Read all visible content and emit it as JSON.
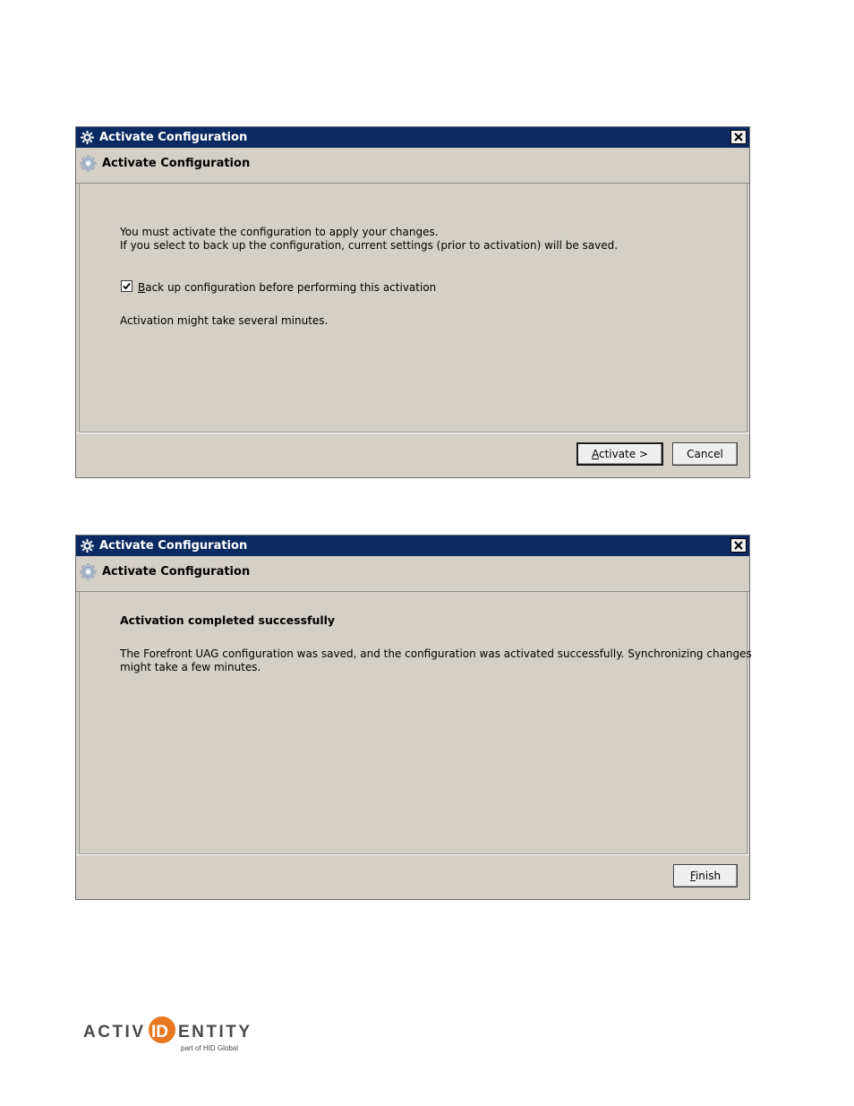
{
  "dialog1": {
    "title": "Activate Configuration",
    "header": "Activate Configuration",
    "line1": "You must activate the configuration to apply your changes.",
    "line2": "If you select to back up the configuration, current settings (prior to activation) will be saved.",
    "checkbox_label_first": "B",
    "checkbox_label_rest": "ack up configuration before performing this activation",
    "checkbox_checked": true,
    "note": "Activation might take several minutes.",
    "activate_first": "A",
    "activate_rest": "ctivate >",
    "cancel_label": "Cancel"
  },
  "dialog2": {
    "title": "Activate Configuration",
    "header": "Activate Configuration",
    "heading": "Activation completed successfully",
    "line1": "The Forefront UAG configuration was saved, and the configuration was activated successfully. Synchronizing changes",
    "line2": "might take a few minutes.",
    "finish_first": "F",
    "finish_rest": "inish"
  },
  "logo": {
    "text_left": "ACTIV",
    "text_mark": "ID",
    "text_right": "ENTITY",
    "tagline": "part of HID Global",
    "accent": "#e87722"
  },
  "colors": {
    "titlebar": "#0b2a62",
    "dialog_bg": "#d4d0c8"
  }
}
